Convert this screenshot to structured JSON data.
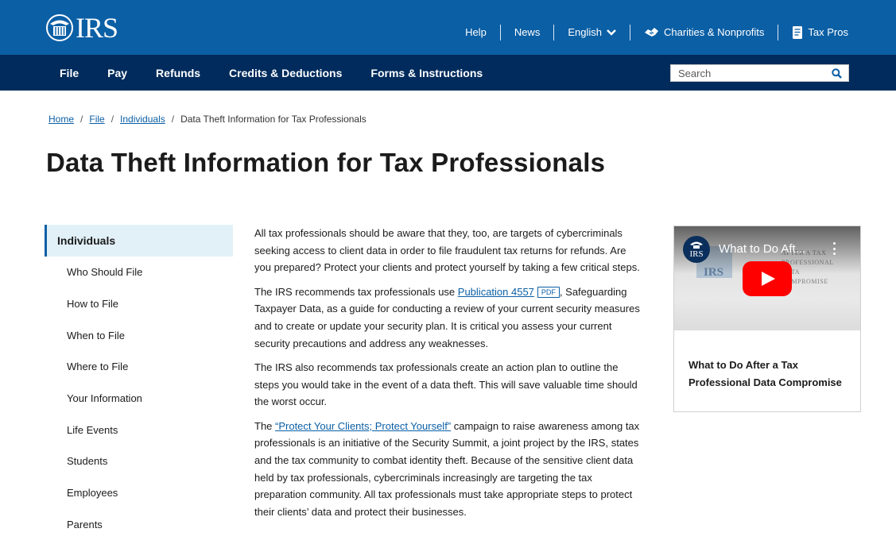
{
  "header": {
    "logo_text": "IRS",
    "utility": {
      "help": "Help",
      "news": "News",
      "language": "English",
      "charities": "Charities & Nonprofits",
      "tax_pros": "Tax Pros"
    }
  },
  "nav": {
    "items": [
      "File",
      "Pay",
      "Refunds",
      "Credits & Deductions",
      "Forms & Instructions"
    ],
    "search_placeholder": "Search"
  },
  "breadcrumb": {
    "home": "Home",
    "file": "File",
    "individuals": "Individuals",
    "current": "Data Theft Information for Tax Professionals",
    "separator": "/"
  },
  "page_title": "Data Theft Information for Tax Professionals",
  "sidebar": {
    "heading": "Individuals",
    "items": [
      "Who Should File",
      "How to File",
      "When to File",
      "Where to File",
      "Your Information",
      "Life Events",
      "Students",
      "Employees",
      "Parents"
    ]
  },
  "article": {
    "p1": "All tax professionals should be aware that they, too, are targets of cybercriminals seeking access to client data in order to file fraudulent tax returns for refunds. Are you prepared? Protect your clients and protect yourself by taking a few critical steps.",
    "p2_before": "The IRS recommends tax professionals use ",
    "p2_link": "Publication 4557",
    "p2_badge": "PDF",
    "p2_after": ", Safeguarding Taxpayer Data, as a guide for conducting a review of your current security measures and to create or update your security plan. It is critical you assess your current security precautions and address any weaknesses.",
    "p3": "The IRS also recommends tax professionals create an action plan to outline the steps you would take in the event of a data theft. This will save valuable time should the worst occur.",
    "p4_before": "The ",
    "p4_link": "“Protect Your Clients; Protect Yourself”",
    "p4_after": " campaign to raise awareness among tax professionals is an initiative of the Security Summit, a joint project by the IRS, states and the tax community to combat identity theft. Because of the sensitive client data held by tax professionals, cybercriminals increasingly are targeting the tax preparation community. All tax professionals must take appropriate steps to protect their clients’ data and protect their businesses."
  },
  "video": {
    "title": "What to Do Aft...",
    "channel_label": "IRS",
    "thumb_seal_text": "IRS",
    "thumb_ghost_text": "AFTER A TAX PROFESSIONAL DATA COMPROMISE",
    "caption": "What to Do After a Tax Professional Data Compromise"
  },
  "colors": {
    "header_blue": "#0b5fa5",
    "nav_navy": "#002b5c",
    "link_blue": "#0b5fa5",
    "sidebar_highlight": "#e2f1f8",
    "youtube_red": "#ff0000"
  },
  "icons": {
    "logo": "irs-eagle-seal-icon",
    "language_chevron": "chevron-down-icon",
    "charities": "handshake-icon",
    "tax_pros": "document-icon",
    "search": "search-icon",
    "play": "play-icon",
    "more": "more-vertical-icon"
  }
}
